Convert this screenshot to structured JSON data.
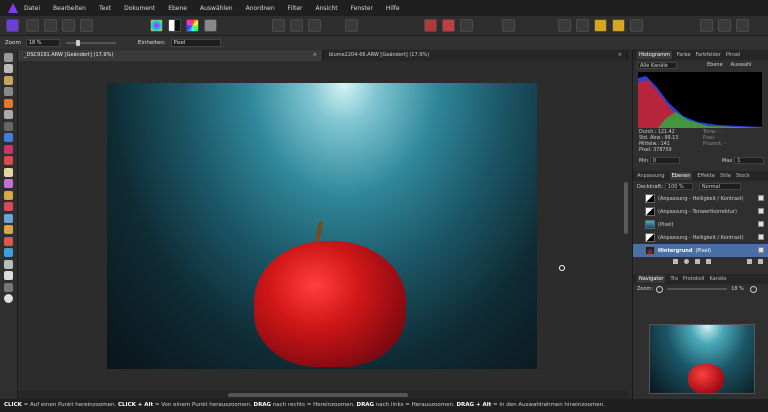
{
  "menubar": {
    "items": [
      "Datei",
      "Bearbeiten",
      "Text",
      "Dokument",
      "Ebene",
      "Auswählen",
      "Anordnen",
      "Filter",
      "Ansicht",
      "Fenster",
      "Hilfe"
    ]
  },
  "context": {
    "zoom_label": "Zoom",
    "zoom_value": "18 %",
    "units_label": "Einheiten:",
    "units_value": "Pixel"
  },
  "documents": {
    "tabs": [
      {
        "label": "_DSC9191.ARW [Geändert] (17.9%)",
        "close": "×"
      },
      {
        "label": "blume2204-66.ARW [Geändert] (17.9%)",
        "close": "×"
      }
    ]
  },
  "panel": {
    "top_tabs": [
      "Histogramm",
      "Farbe",
      "Farbfelder",
      "Pinsel"
    ],
    "channel_select": "Alle Kanäle",
    "layer_check": "Ebene",
    "selection_check": "Auswahl",
    "stats_left": [
      "Durch.: 121.42",
      "Std. Abw.: 99.13",
      "Mittelw.: 141",
      "Pixel: 378759"
    ],
    "stats_right": [
      "Tonw.: -",
      "Pixel: -",
      "Prozent: -"
    ],
    "min_label": "Min",
    "min_value": "0",
    "max_label": "Max",
    "max_value": "1",
    "mid_tabs": [
      "Anpassung",
      "Ebenen",
      "Effekte",
      "Stile",
      "Stock"
    ],
    "opacity_label": "Deckkraft:",
    "opacity_value": "100 %",
    "blend_value": "Normal",
    "layers": [
      {
        "name": "(Anpassung - Helligkeit / Kontrast)"
      },
      {
        "name": "(Anpassung - Tonwertkorrektur)"
      },
      {
        "name": "(Pixel)"
      },
      {
        "name": "(Anpassung - Helligkeit / Kontrast)"
      },
      {
        "name": "Hintergrund",
        "suffix": "(Pixel)"
      }
    ],
    "nav_tabs": [
      "Navigator",
      "Tra",
      "Protokoll",
      "Kanäle"
    ],
    "nav_zoom_label": "Zoom:",
    "nav_zoom_value": "18 %"
  },
  "status": {
    "parts": [
      {
        "b": "CLICK",
        "t": " = Auf einen Punkt hereinzoomen. "
      },
      {
        "b": "CLICK + Alt",
        "t": " = Von einem Punkt herauszoomen. "
      },
      {
        "b": "DRAG",
        "t": " nach rechts = Hereinzoomen. "
      },
      {
        "b": "DRAG",
        "t": " nach links = Herauszoomen. "
      },
      {
        "b": "DRAG + Alt",
        "t": " = In den Auswahlrahmen hineinzoomen."
      }
    ]
  },
  "colors": {
    "accent": "#4a6fa5",
    "app_bg": "#2b2b2b",
    "brand": "#7b3ff2"
  }
}
